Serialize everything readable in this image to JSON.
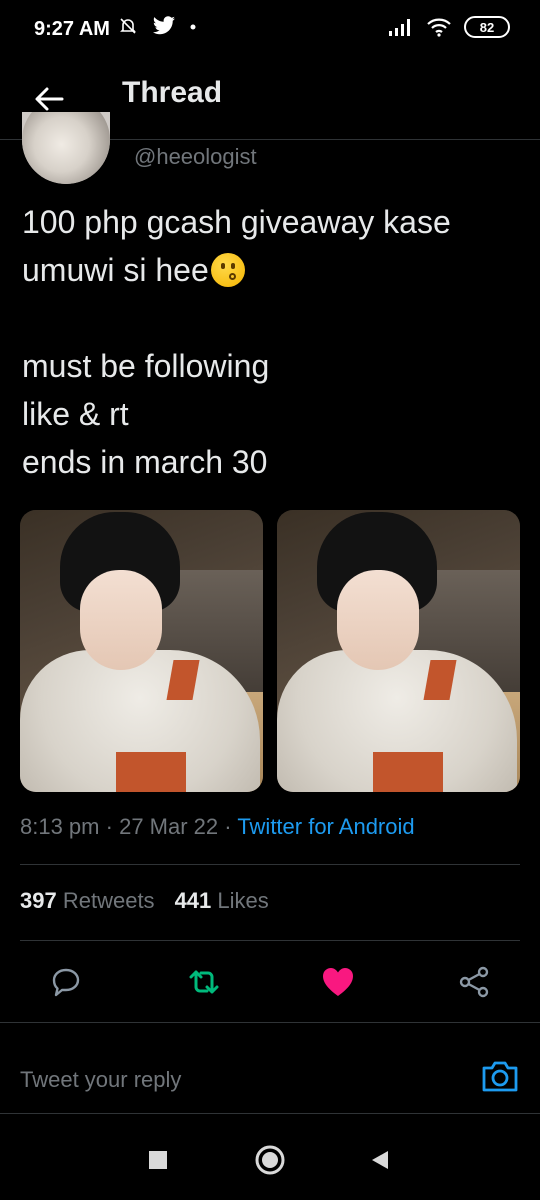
{
  "status_bar": {
    "time": "9:27 AM",
    "battery": "82",
    "icons": [
      "mute-bell-icon",
      "twitter-bird-icon",
      "dot-icon",
      "signal-icon",
      "wifi-icon",
      "battery-icon"
    ]
  },
  "header": {
    "title": "Thread",
    "back_icon": "back-arrow-icon"
  },
  "tweet": {
    "handle": "@heeologist",
    "text_line1": "100 php gcash giveaway kase",
    "text_line2": "umuwi si hee",
    "emoji": "kissing-face-emoji",
    "text_rest": "must be following\nlike & rt\nends in march 30",
    "photo_count": 2,
    "time": "8:13 pm",
    "date": "27 Mar 22",
    "separator": "·",
    "source": "Twitter for Android",
    "retweets_count": "397",
    "retweets_label": "Retweets",
    "likes_count": "441",
    "likes_label": "Likes"
  },
  "actions": {
    "reply_icon": "reply-bubble-icon",
    "retweet_icon": "retweet-icon",
    "like_icon": "heart-icon",
    "share_icon": "share-icon",
    "retweet_color": "#00ba7c",
    "like_color": "#f91880"
  },
  "reply": {
    "placeholder": "Tweet your reply",
    "camera_icon": "camera-icon",
    "accent": "#1d9bf0"
  },
  "navbar": {
    "buttons": [
      "square-recents-icon",
      "circle-home-icon",
      "triangle-back-icon"
    ]
  }
}
